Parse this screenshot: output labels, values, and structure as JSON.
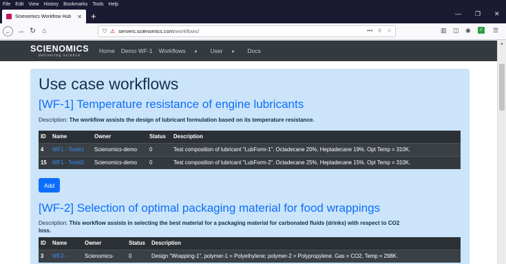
{
  "browser": {
    "menu": [
      "File",
      "Edit",
      "View",
      "History",
      "Bookmarks",
      "Tools",
      "Help"
    ],
    "tab_title": "Scienomics Workflow Hub",
    "url_domain": "servers.scienomics.com",
    "url_path": "/workflows/"
  },
  "site": {
    "brand_name": "SCIENOMICS",
    "brand_tagline": "delivering science",
    "nav": {
      "home": "Home",
      "demo": "Demo WF-1",
      "workflows": "Workflows",
      "user": "User",
      "docs": "Docs"
    }
  },
  "page": {
    "title": "Use case workflows",
    "description_label": "Description:",
    "add_label": "Add",
    "columns": {
      "id": "ID",
      "name": "Name",
      "owner": "Owner",
      "status": "Status",
      "description": "Description"
    },
    "wf1": {
      "heading": "[WF-1] Temperature resistance of engine lubricants",
      "description": "The workflow assists the design of lubricant formulation based on its temperature resistance.",
      "rows": [
        {
          "id": "4",
          "name": "WF1 - Test#1",
          "owner": "Scienomics-demo",
          "status": "0",
          "description": "Test composition of lubricant \"LubForm-1\". Octadecane 20%, Heptadecane 19%. Opt Temp = 310K."
        },
        {
          "id": "15",
          "name": "WF1 - Test#2",
          "owner": "Scienomics-demo",
          "status": "0",
          "description": "Test composition of lubricant \"LubForm-2\". Octadecane 25%, Heptadecane 15%. Opt Temp = 310K."
        }
      ]
    },
    "wf2": {
      "heading": "[WF-2] Selection of optimal packaging material for food wrappings",
      "description_line1": "This workflow assists in selecting the best material for a packaging material for carbonated fluids (drinks) with respect to CO2",
      "description_line2": "loss.",
      "rows": [
        {
          "id": "3",
          "name": "WF2-",
          "owner": "Scienomics-",
          "status": "0",
          "description": "Design \"Wrapping-1\", polymer-1 = Polyethylene; polymer-2 = Polypropylene. Gas = CO2, Temp = 298K."
        }
      ]
    }
  },
  "colors": {
    "navbar": "#343a40",
    "jumbotron": "#cbe4f9",
    "primary": "#0d6efd",
    "table": "#343a40"
  }
}
